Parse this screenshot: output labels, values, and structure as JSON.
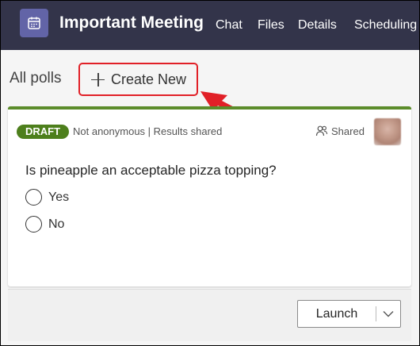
{
  "header": {
    "title": "Important Meeting",
    "tabs": [
      {
        "label": "Chat"
      },
      {
        "label": "Files"
      },
      {
        "label": "Details"
      },
      {
        "label": "Scheduling A"
      }
    ]
  },
  "toolbar": {
    "all_polls_label": "All polls",
    "create_label": "Create New"
  },
  "poll": {
    "status_badge": "DRAFT",
    "meta": "Not anonymous | Results shared",
    "shared_label": "Shared",
    "question": "Is pineapple an acceptable pizza topping?",
    "options": [
      {
        "label": "Yes"
      },
      {
        "label": "No"
      }
    ]
  },
  "footer": {
    "launch_label": "Launch"
  },
  "colors": {
    "header_bg": "#33344a",
    "app_icon_bg": "#6264a7",
    "draft_green": "#4d7f1c",
    "card_accent": "#5b8c2a",
    "highlight_red": "#e12027"
  },
  "icons": {
    "app": "calendar-icon",
    "create": "plus-icon",
    "shared": "people-icon",
    "dropdown": "chevron-down-icon",
    "annotation": "red-arrow"
  }
}
